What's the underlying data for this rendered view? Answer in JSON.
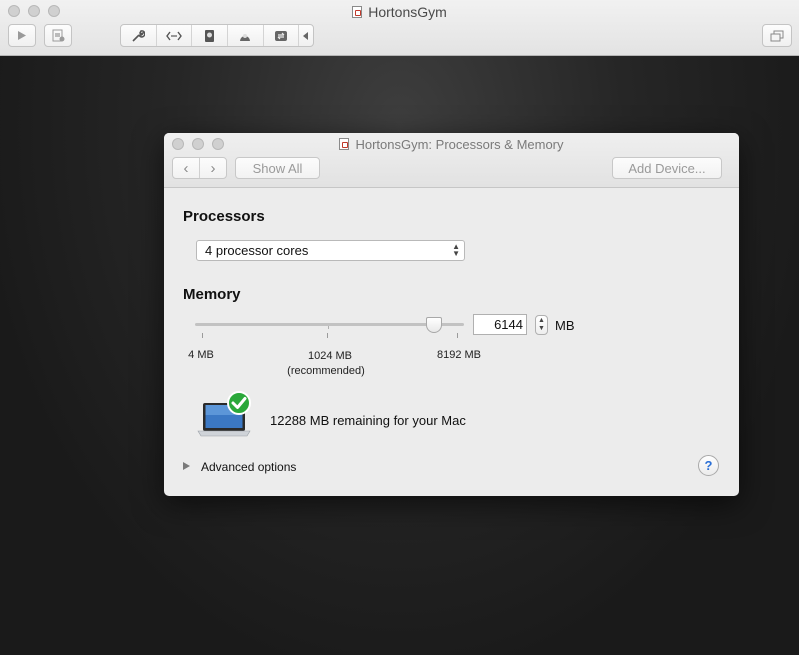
{
  "main_window": {
    "title": "HortonsGym",
    "toolbar": {
      "play_icon": "play-icon",
      "snapshot_icon": "snapshot-icon",
      "settings_icon": "wrench-icon",
      "network_icon": "network-icon",
      "disk_icon": "disk-icon",
      "camera_icon": "camera-icon",
      "sync_icon": "sync-icon",
      "collapse_icon": "triangle-left-icon",
      "window_icon": "window-icon"
    }
  },
  "sheet": {
    "title": "HortonsGym: Processors & Memory",
    "nav": {
      "back": "‹",
      "forward": "›"
    },
    "show_all_label": "Show All",
    "add_device_label": "Add Device...",
    "processors": {
      "heading": "Processors",
      "selected": "4 processor cores"
    },
    "memory": {
      "heading": "Memory",
      "slider_value_mb": 6144,
      "tick_min": "4 MB",
      "tick_recommended": "1024 MB",
      "tick_recommended_note": "(recommended)",
      "tick_max": "8192 MB",
      "value": "6144",
      "unit": "MB"
    },
    "remaining_text": "12288 MB remaining for your Mac",
    "advanced_label": "Advanced options",
    "help_label": "?"
  }
}
